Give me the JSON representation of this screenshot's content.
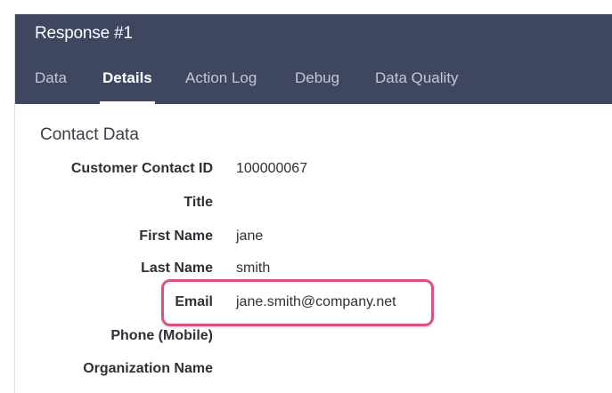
{
  "header": {
    "title": "Response #1"
  },
  "tabs": [
    {
      "label": "Data",
      "active": false
    },
    {
      "label": "Details",
      "active": true
    },
    {
      "label": "Action Log",
      "active": false
    },
    {
      "label": "Debug",
      "active": false
    },
    {
      "label": "Data Quality",
      "active": false
    }
  ],
  "section": {
    "title": "Contact Data"
  },
  "fields": [
    {
      "label": "Customer Contact ID",
      "value": "100000067"
    },
    {
      "label": "Title",
      "value": ""
    },
    {
      "label": "First Name",
      "value": "jane"
    },
    {
      "label": "Last Name",
      "value": "smith"
    },
    {
      "label": "Email",
      "value": "jane.smith@company.net"
    },
    {
      "label": "Phone (Mobile)",
      "value": ""
    },
    {
      "label": "Organization Name",
      "value": ""
    }
  ],
  "colors": {
    "header_bg": "#3f4660",
    "highlight_border": "#e0507a"
  }
}
